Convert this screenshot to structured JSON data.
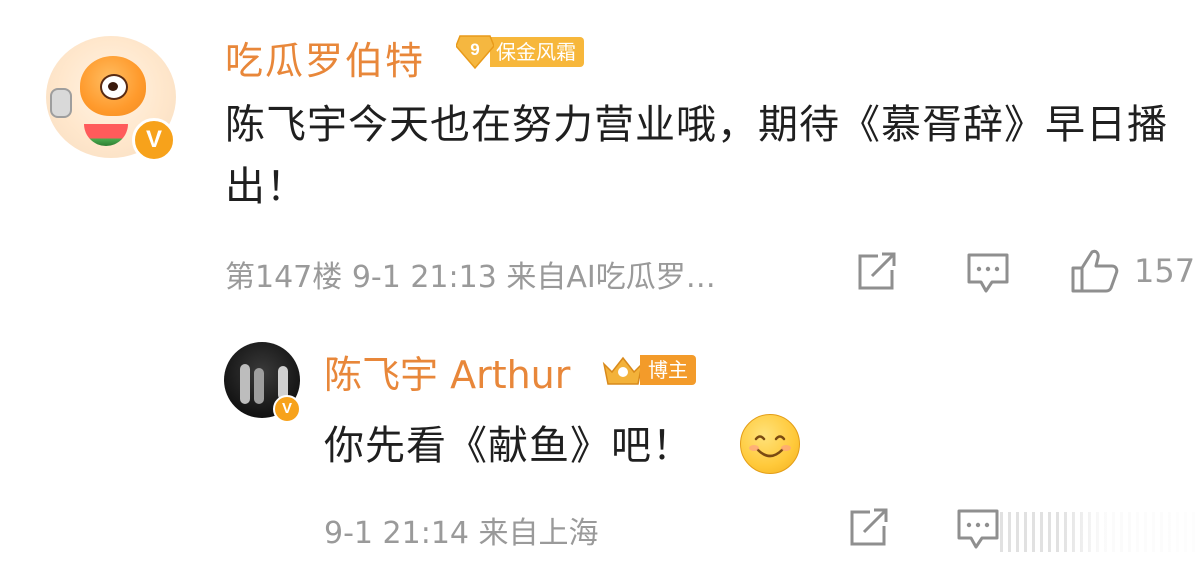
{
  "comment": {
    "author": "吃瓜罗伯特",
    "fan_level": "9",
    "fan_badge": "保金风霜",
    "text": "陈飞宇今天也在努力营业哦，期待《慕胥辞》早日播出！",
    "floor": "第147楼",
    "time": "9-1 21:13",
    "source": "来自AI吃瓜罗…",
    "like_count": "157",
    "verified_mark": "V"
  },
  "reply": {
    "author": "陈飞宇 Arthur",
    "role_badge": "博主",
    "text": "你先看《献鱼》吧！",
    "time": "9-1 21:14",
    "source": "来自上海",
    "verified_mark": "V"
  },
  "icons": {
    "share": "share-icon",
    "comment": "comment-icon",
    "like": "thumbs-up-icon",
    "emoji": "smile-emoji"
  },
  "colors": {
    "username": "#e8873a",
    "meta": "#9a9a9a",
    "badge_gold": "#f7b73b",
    "verified": "#f7a21b"
  }
}
